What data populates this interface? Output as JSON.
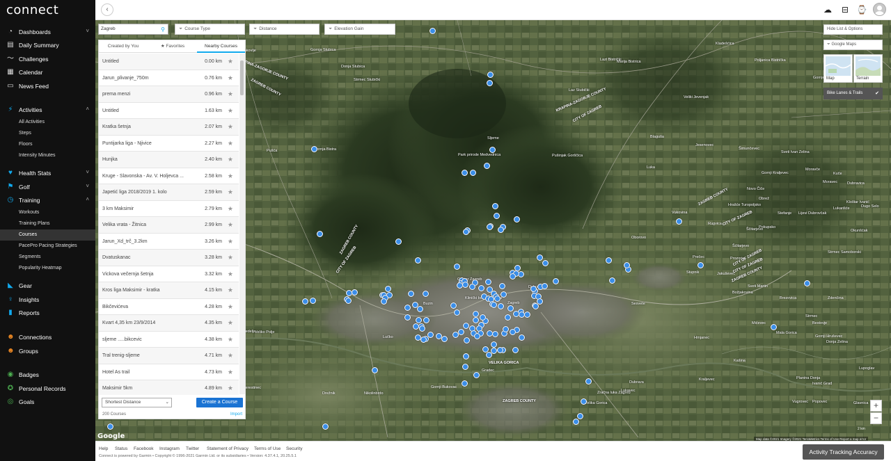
{
  "brand": {
    "logo": "connect"
  },
  "sidebar": {
    "sections": [
      {
        "label": "Dashboards",
        "icon": "speedometer-icon",
        "chev": "˅"
      },
      {
        "label": "Daily Summary",
        "icon": "calendar-day-icon"
      },
      {
        "label": "Challenges",
        "icon": "challenges-icon"
      },
      {
        "label": "Calendar",
        "icon": "calendar-icon"
      },
      {
        "label": "News Feed",
        "icon": "newsfeed-icon"
      },
      {
        "label": "Activities",
        "icon": "running-icon",
        "chev": "˄"
      },
      {
        "label": "Health Stats",
        "icon": "heart-icon",
        "chev": "˅"
      },
      {
        "label": "Golf",
        "icon": "golf-icon",
        "chev": "˅"
      },
      {
        "label": "Training",
        "icon": "stopwatch-icon",
        "chev": "˄"
      },
      {
        "label": "Gear",
        "icon": "shoe-icon"
      },
      {
        "label": "Insights",
        "icon": "lightbulb-icon"
      },
      {
        "label": "Reports",
        "icon": "chart-icon"
      },
      {
        "label": "Connections",
        "icon": "people-icon"
      },
      {
        "label": "Groups",
        "icon": "groups-icon"
      },
      {
        "label": "Badges",
        "icon": "badge-icon"
      },
      {
        "label": "Personal Records",
        "icon": "medal-icon"
      },
      {
        "label": "Goals",
        "icon": "target-icon"
      }
    ],
    "activities_sub": [
      "All Activities",
      "Steps",
      "Floors",
      "Intensity Minutes"
    ],
    "training_sub": [
      "Workouts",
      "Training Plans",
      "Courses",
      "PacePro Pacing Strategies",
      "Segments",
      "Popularity Heatmap"
    ]
  },
  "filters": {
    "search_value": "Zagreb",
    "course_type": "Course Type",
    "distance": "Distance",
    "elevation": "Elevation Gain"
  },
  "panel": {
    "tabs": [
      "Created by You",
      "Favorites",
      "Nearby Courses"
    ],
    "courses": [
      {
        "name": "Untitled",
        "distance": "0.00 km"
      },
      {
        "name": "Jarun_plivanje_750m",
        "distance": "0.76 km"
      },
      {
        "name": "prema menzi",
        "distance": "0.96 km"
      },
      {
        "name": "Untitled",
        "distance": "1.63 km"
      },
      {
        "name": "Kratka šetnja",
        "distance": "2.07 km"
      },
      {
        "name": "Puntijarka liga - Njivice",
        "distance": "2.27 km"
      },
      {
        "name": "Hunjka",
        "distance": "2.40 km"
      },
      {
        "name": "Kruge - Slavonska - Av. V. Holjevca ...",
        "distance": "2.58 km"
      },
      {
        "name": "Japetić liga 2018/2019 1. kolo",
        "distance": "2.59 km"
      },
      {
        "name": "3 km Maksimir",
        "distance": "2.79 km"
      },
      {
        "name": "Velika vrata - Žitnica",
        "distance": "2.99 km"
      },
      {
        "name": "Jarun_Xd_trč_3.2km",
        "distance": "3.26 km"
      },
      {
        "name": "Dvatuskanac",
        "distance": "3.28 km"
      },
      {
        "name": "Vickova večernja šetnja",
        "distance": "3.32 km"
      },
      {
        "name": "Kros liga Maksimir - kratka",
        "distance": "4.15 km"
      },
      {
        "name": "Bikčevićeva",
        "distance": "4.28 km"
      },
      {
        "name": "Kvart 4,35 km 23/9/2014",
        "distance": "4.35 km"
      },
      {
        "name": "sljeme .....bikcevic",
        "distance": "4.38 km"
      },
      {
        "name": "Tral trenig-sljeme",
        "distance": "4.71 km"
      },
      {
        "name": "Hotel As trail",
        "distance": "4.73 km"
      },
      {
        "name": "Maksimir 5km",
        "distance": "4.89 km"
      }
    ],
    "sort": "Shortest Distance",
    "create": "Create a Course",
    "count": "200 Courses",
    "import": "Import"
  },
  "map_controls": {
    "hide_list": "Hide List & Options",
    "google_maps": "Google Maps",
    "map": "Map",
    "terrain": "Terrain",
    "bike_lanes": "Bike Lanes & Trails",
    "zoom_in": "+",
    "zoom_out": "−",
    "google": "Google",
    "attribution": "Map data ©2021 Imagery ©2021 TerraMetrics    Terms of Use    Report a map error",
    "scale": "2 km"
  },
  "map_labels": [
    "Pavlova Vas",
    "Gubaševo",
    "Kladešćica",
    "Gornja Stubica",
    "Jakovlje",
    "Donja Stubica",
    "Lazi Bistrički",
    "Marija Bistrica",
    "Poljanica Bistrička",
    "Hum Zabočki",
    "Strmec Stubički",
    "Sveti Križ Začretje",
    "Gornje Orešje",
    "Laz Stubički",
    "Veliki Jevenjak",
    "Gornji Stupnik",
    "Park prirode Medvednica",
    "Sljeme",
    "Pušinjak Gorščica",
    "Blaguša",
    "Jesenovec",
    "Šimunčevec",
    "Pušća",
    "Gornja Bistra",
    "Bistra",
    "Marija Gorica",
    "Luka",
    "Gornji Kraljevec",
    "Moravče",
    "Moravec",
    "Sesvete",
    "Zagreb",
    "Centar Zagreb",
    "Klinički bolnički centar",
    "Dubrava",
    "Sveta Nedelja",
    "Veliko Polje",
    "Lučko",
    "Buzin",
    "Velika Gorica",
    "Zračna luka Zagreb",
    "Lukavec",
    "Rakitje",
    "Kerestinec",
    "Drežnik",
    "Nikolinbrdo",
    "Gornji Bukovac",
    "Gradec",
    "Dubrava",
    "Kraljevec",
    "Lupoglav",
    "Ivanić Grad",
    "Mala Gorica",
    "Sveti Ivan Zelina",
    "Dubravica",
    "Kuče",
    "Novo Čiče",
    "Kloštar Ivanić",
    "Obrež",
    "Hrašće Turopoljsko",
    "Pokupsko",
    "Mićevec",
    "Brezovica",
    "Zdenčina",
    "Strmec",
    "Strmec Samoborski",
    "Bestovje",
    "Stupnik",
    "Jakuševec",
    "Ščitarjevo",
    "Vukovina",
    "Šćitarjevo",
    "Oborovo",
    "Rugvica",
    "Prečec",
    "Stefanje",
    "Lijevi Dubrovčak",
    "Okunšćak",
    "Dugo Selo",
    "Prozorje",
    "Lukarišće",
    "Sveti Martin",
    "Božjakovina",
    "Gornji Hruševec",
    "Donja Zelina",
    "Hrnjanec",
    "Kašina",
    "Planina Donja",
    "Vugrovec",
    "Glavnica",
    "Popovec",
    "Brestje",
    "Kraljevec na Sutli"
  ],
  "region_labels": [
    "KRAPINA-ZAGORJE COUNTY",
    "ZAGREB COUNTY",
    "KRAPINA-ZAGORJE COUNTY",
    "CITY OF ZAGREB",
    "CITY OF ZAGREB",
    "ZAGREB COUNTY",
    "ZAGREB COUNTY",
    "CITY OF ZAGREB",
    "CITY OF ZAGREB",
    "ZAGREB COUNTY",
    "CITY OF ZAGREB",
    "VELIKA GORICA",
    "ZAGREB COUNTY"
  ],
  "footer": {
    "links": [
      "Help",
      "Status",
      "Facebook",
      "Instagram",
      "Twitter",
      "Statement of Privacy",
      "Terms of Use",
      "Security"
    ],
    "copyright": "Connect is powered by Garmin • Copyright © 1996-2021 Garmin Ltd. or its subsidiaries • Version: 4.37.4.1, 20.25.5.1",
    "tracking": "Activity Tracking Accuracy"
  },
  "colors": {
    "accent": "#11a9ed",
    "button": "#1a73d3",
    "sidebar": "#111111",
    "marker": "#3b8ee8"
  }
}
